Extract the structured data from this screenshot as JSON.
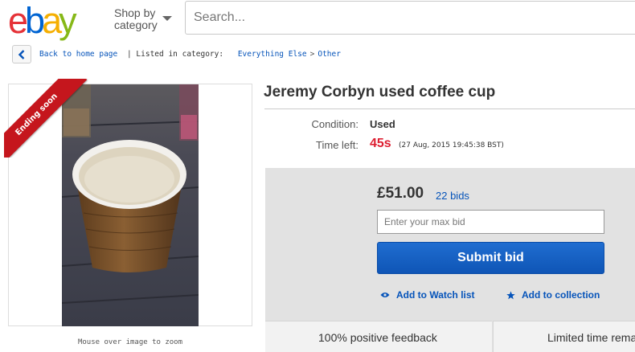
{
  "header": {
    "logo": {
      "letters": [
        "e",
        "b",
        "a",
        "y"
      ],
      "colors": [
        "#e53238",
        "#0064d2",
        "#f5af02",
        "#86b817"
      ]
    },
    "shop_by_line1": "Shop by",
    "shop_by_line2": "category",
    "search_placeholder": "Search..."
  },
  "breadcrumb": {
    "back_label": "Back to home page",
    "listed_label": "| Listed in category:",
    "category": "Everything Else",
    "separator": ">",
    "subcategory": "Other"
  },
  "image": {
    "ribbon": "Ending soon",
    "zoom_note": "Mouse over image to zoom"
  },
  "item": {
    "title": "Jeremy Corbyn used coffee cup",
    "condition_label": "Condition:",
    "condition_value": "Used",
    "time_left_label": "Time left:",
    "time_left_value": "45s",
    "end_time": "(27 Aug, 2015  19:45:38 BST)"
  },
  "bid": {
    "price": "£51.00",
    "bid_count": "22 bids",
    "max_bid_placeholder": "Enter your max bid",
    "submit_label": "Submit bid",
    "watch_label": "Add to Watch list",
    "collection_label": "Add to collection"
  },
  "tiles": {
    "feedback": "100% positive feedback",
    "limited": "Limited time rema"
  },
  "colors": {
    "link": "#0654ba",
    "time_left": "#dd1e31",
    "ribbon": "#c5161d",
    "submit": "#0f55b6"
  }
}
